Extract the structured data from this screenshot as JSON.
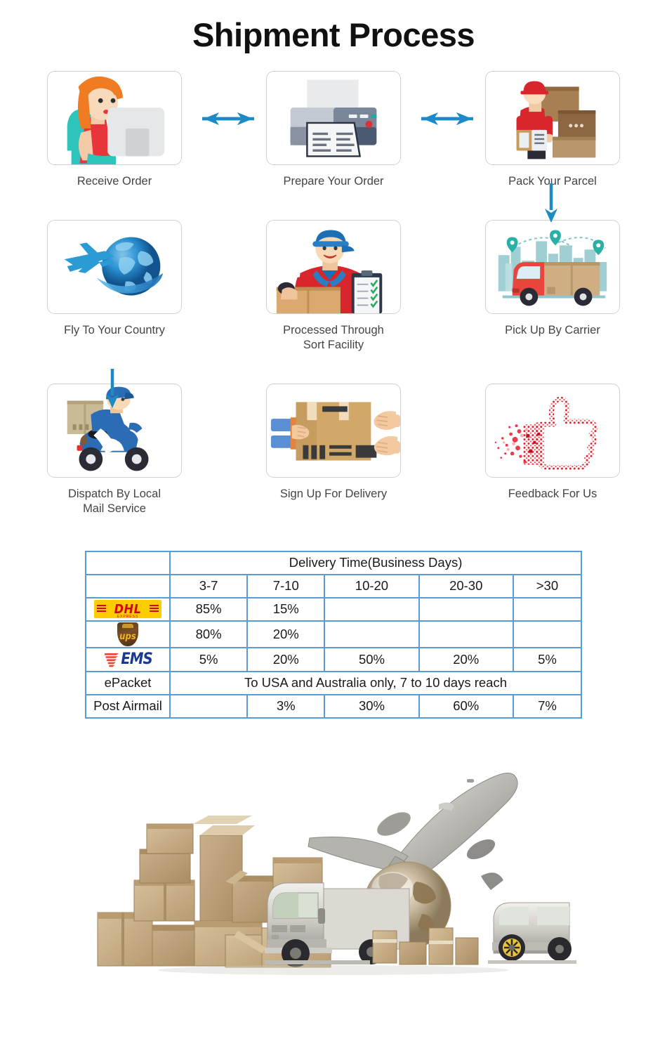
{
  "title": "Shipment Process",
  "process": {
    "rows": [
      {
        "cells": [
          {
            "label": "Receive Order",
            "icon": "person-at-computer-icon"
          },
          {
            "label": "Prepare Your Order",
            "icon": "printer-icon"
          },
          {
            "label": "Pack Your Parcel",
            "icon": "worker-packing-boxes-icon"
          }
        ]
      },
      {
        "cells": [
          {
            "label": "Fly To Your Country",
            "icon": "airplane-globe-icon"
          },
          {
            "label": "Processed Through\nSort Facility",
            "label_line1": "Processed Through",
            "label_line2": "Sort Facility",
            "icon": "worker-with-checklist-icon"
          },
          {
            "label": "Pick Up By Carrier",
            "icon": "delivery-truck-city-icon"
          }
        ]
      },
      {
        "cells": [
          {
            "label": "Dispatch By Local\nMail Service",
            "label_line1": "Dispatch By Local",
            "label_line2": "Mail Service",
            "icon": "scooter-courier-icon"
          },
          {
            "label": "Sign Up For Delivery",
            "icon": "package-handoff-icon"
          },
          {
            "label": "Feedback For Us",
            "icon": "thumbs-up-icon"
          }
        ]
      }
    ]
  },
  "colors": {
    "arrow": "#1b8ac7",
    "table_border": "#5b9bd5",
    "dhl_yellow": "#ffcc00",
    "dhl_red": "#d40511",
    "ups_brown": "#5c3a1e",
    "ups_gold": "#f0b323",
    "ems_red": "#e8472b",
    "ems_blue": "#1a3a8f",
    "thumb_red": "#e8192c",
    "card_border": "#cfcfcf"
  },
  "table": {
    "header_main": "Delivery Time(Business Days)",
    "columns": [
      "3-7",
      "7-10",
      "10-20",
      "20-30",
      ">30"
    ],
    "rows": [
      {
        "carrier": "DHL",
        "carrier_type": "logo",
        "logo": "dhl-logo",
        "logo_text": "DHL",
        "logo_subtext": "EXPRESS",
        "values": [
          "85%",
          "15%",
          "",
          "",
          ""
        ]
      },
      {
        "carrier": "UPS",
        "carrier_type": "logo",
        "logo": "ups-logo",
        "logo_text": "ups",
        "values": [
          "80%",
          "20%",
          "",
          "",
          ""
        ]
      },
      {
        "carrier": "EMS",
        "carrier_type": "logo",
        "logo": "ems-logo",
        "logo_text": "EMS",
        "values": [
          "5%",
          "20%",
          "50%",
          "20%",
          "5%"
        ]
      },
      {
        "carrier": "ePacket",
        "carrier_type": "text",
        "span_text": "To USA and Australia only, 7 to 10 days reach"
      },
      {
        "carrier": "Post Airmail",
        "carrier_type": "text",
        "values": [
          "",
          "3%",
          "30%",
          "60%",
          "7%"
        ]
      }
    ]
  },
  "bottom_image": {
    "alt": "logistics-composite-photo",
    "elements": [
      "cardboard-boxes",
      "semi-truck",
      "globe",
      "airplane",
      "delivery-van"
    ]
  }
}
